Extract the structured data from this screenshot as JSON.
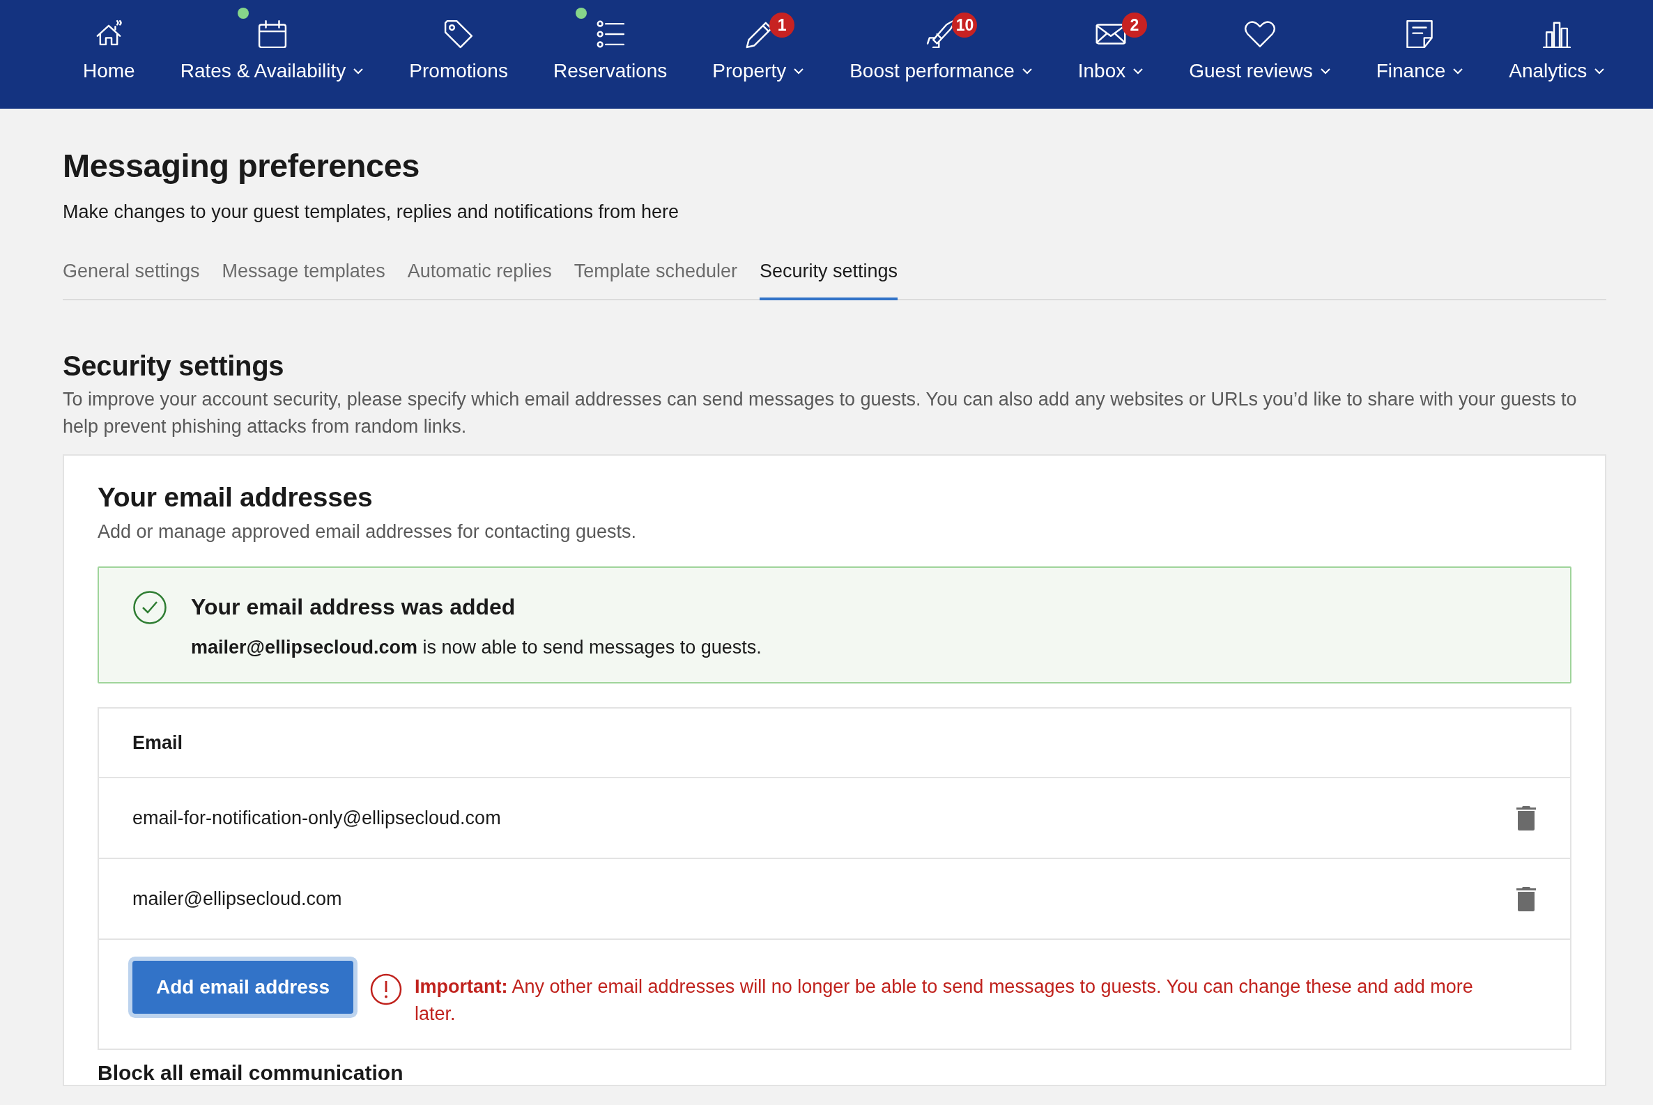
{
  "nav": [
    {
      "label": "Home",
      "dropdown": false,
      "dot": false
    },
    {
      "label": "Rates & Availability",
      "dropdown": true,
      "dot": true
    },
    {
      "label": "Promotions",
      "dropdown": false,
      "dot": false
    },
    {
      "label": "Reservations",
      "dropdown": false,
      "dot": true
    },
    {
      "label": "Property",
      "dropdown": true,
      "dot": false,
      "badge": "1"
    },
    {
      "label": "Boost performance",
      "dropdown": true,
      "dot": false,
      "badge": "10"
    },
    {
      "label": "Inbox",
      "dropdown": true,
      "dot": false,
      "badge": "2"
    },
    {
      "label": "Guest reviews",
      "dropdown": true,
      "dot": false
    },
    {
      "label": "Finance",
      "dropdown": true,
      "dot": false
    },
    {
      "label": "Analytics",
      "dropdown": true,
      "dot": false
    }
  ],
  "page": {
    "title": "Messaging preferences",
    "subtitle": "Make changes to your guest templates, replies and notifications from here"
  },
  "tabs": [
    {
      "label": "General settings",
      "selected": false
    },
    {
      "label": "Message templates",
      "selected": false
    },
    {
      "label": "Automatic replies",
      "selected": false
    },
    {
      "label": "Template scheduler",
      "selected": false
    },
    {
      "label": "Security settings",
      "selected": true
    }
  ],
  "section": {
    "title": "Security settings",
    "description": "To improve your account security, please specify which email addresses can send messages to guests. You can also add any websites or URLs you’d like to share with your guests to help prevent phishing attacks from random links."
  },
  "email_card": {
    "title": "Your email addresses",
    "subtitle": "Add or manage approved email addresses for contacting guests.",
    "success": {
      "title": "Your email address was added",
      "message": "**mailer@ellipsecloud.com** is now able to send messages to guests."
    },
    "table": {
      "column": "Email",
      "rows": [
        "email-for-notification-only@ellipsecloud.com",
        "mailer@ellipsecloud.com"
      ]
    },
    "add_button": "Add email address",
    "warning": "**Important:** Any other email addresses will no longer be able to send messages to guests. You can change these and add more later."
  },
  "next_section": {
    "title": "Block all email communication"
  }
}
